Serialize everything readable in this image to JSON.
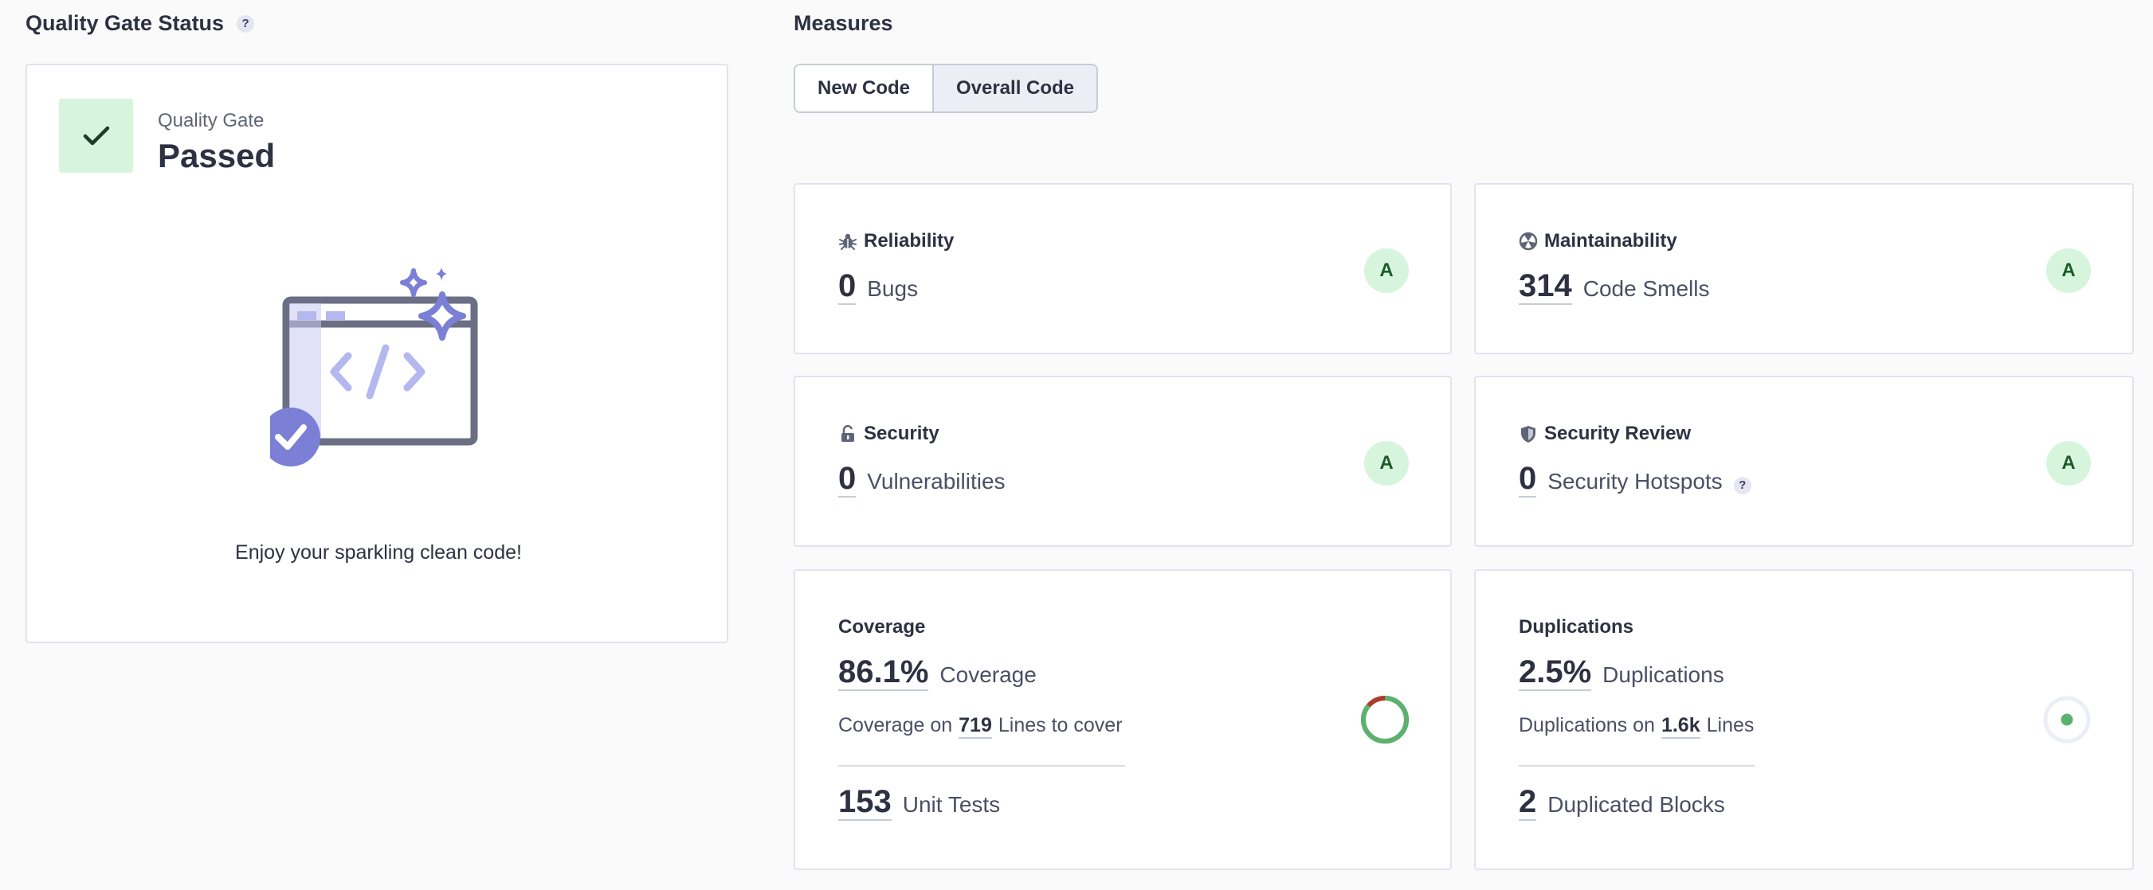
{
  "quality_gate": {
    "heading": "Quality Gate Status",
    "help": "?",
    "label": "Quality Gate",
    "status": "Passed",
    "message": "Enjoy your sparkling clean code!",
    "status_icon": "check-icon",
    "status_color": "#d7f5dd"
  },
  "measures": {
    "heading": "Measures",
    "tabs": [
      {
        "label": "New Code",
        "selected": false
      },
      {
        "label": "Overall Code",
        "selected": true
      }
    ],
    "reliability": {
      "title": "Reliability",
      "value": "0",
      "unit": "Bugs",
      "rating": "A",
      "icon": "bug-icon"
    },
    "maintainability": {
      "title": "Maintainability",
      "value": "314",
      "unit": "Code Smells",
      "rating": "A",
      "icon": "code-smell-icon"
    },
    "security": {
      "title": "Security",
      "value": "0",
      "unit": "Vulnerabilities",
      "rating": "A",
      "icon": "lock-icon"
    },
    "security_review": {
      "title": "Security Review",
      "value": "0",
      "unit": "Security Hotspots",
      "help": "?",
      "rating": "A",
      "icon": "shield-icon"
    },
    "coverage": {
      "title": "Coverage",
      "value": "86.1%",
      "unit": "Coverage",
      "sub_prefix": "Coverage on",
      "sub_value": "719",
      "sub_suffix": "Lines to cover",
      "tests_value": "153",
      "tests_unit": "Unit Tests",
      "donut_fraction": 0.861
    },
    "duplications": {
      "title": "Duplications",
      "value": "2.5%",
      "unit": "Duplications",
      "sub_prefix": "Duplications on",
      "sub_value": "1.6k",
      "sub_suffix": "Lines",
      "blocks_value": "2",
      "blocks_unit": "Duplicated Blocks"
    }
  },
  "colors": {
    "rating_bg": "#d7f5dd",
    "rating_fg": "#1d5b2a",
    "accent": "#7b80d6",
    "coverage_green": "#5bb26f",
    "uncovered_red": "#b13a2a"
  }
}
